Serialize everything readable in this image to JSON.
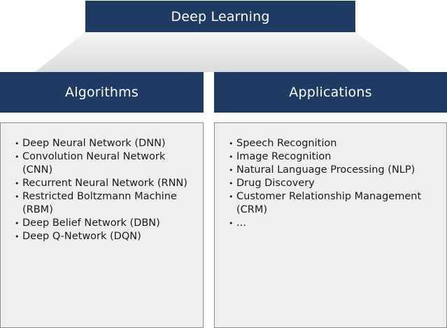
{
  "top": {
    "title": "Deep Learning"
  },
  "algorithms": {
    "title": "Algorithms",
    "items": [
      "Deep Neural Network (DNN)",
      "Convolution Neural Network (CNN)",
      "Recurrent Neural Network (RNN)",
      "Restricted Boltzmann Machine (RBM)",
      "Deep Belief Network (DBN)",
      "Deep Q-Network (DQN)"
    ]
  },
  "applications": {
    "title": "Applications",
    "items": [
      "Speech Recognition",
      "Image Recognition",
      "Natural Language Processing (NLP)",
      "Drug Discovery",
      "Customer Relationship Management (CRM)",
      "..."
    ]
  },
  "colors": {
    "header_fill": "#1f3b64",
    "panel_fill": "#efefef",
    "connector_fill": "#e8e8e8"
  }
}
